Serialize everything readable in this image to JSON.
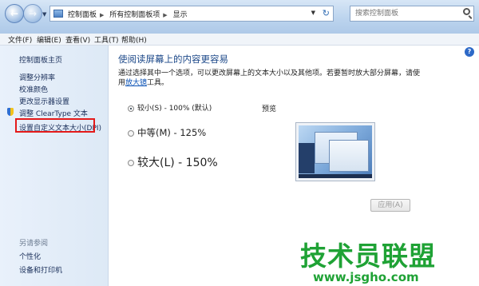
{
  "address": {
    "breadcrumbs": [
      "控制面板",
      "所有控制面板项",
      "显示"
    ],
    "search_placeholder": "搜索控制面板"
  },
  "menu": [
    "文件(F)",
    "编辑(E)",
    "查看(V)",
    "工具(T)",
    "帮助(H)"
  ],
  "sidebar": {
    "home": "控制面板主页",
    "items": [
      "调整分辨率",
      "校准颜色",
      "更改显示器设置",
      "调整 ClearType 文本",
      "设置自定义文本大小(DPI)"
    ],
    "see_also_title": "另请参阅",
    "see_also": [
      "个性化",
      "设备和打印机"
    ]
  },
  "main": {
    "heading": "使阅读屏幕上的内容更容易",
    "description": "通过选择其中一个选项，可以更改屏幕上的文本大小以及其他项。若要暂时放大部分屏幕，请使用",
    "magnifier_link": "放大镜",
    "description_end": "工具。",
    "options": [
      {
        "label": "较小(S) - 100% (默认)",
        "selected": true
      },
      {
        "label": "中等(M) - 125%",
        "selected": false
      },
      {
        "label": "较大(L) - 150%",
        "selected": false
      }
    ],
    "preview_label": "预览",
    "apply_button": "应用(A)"
  },
  "watermark": {
    "text": "技术员联盟",
    "url": "www.jsgho.com"
  },
  "colors": {
    "highlight_box": "#e41a1a",
    "watermark": "#1fa235",
    "link": "#0b52b5"
  }
}
